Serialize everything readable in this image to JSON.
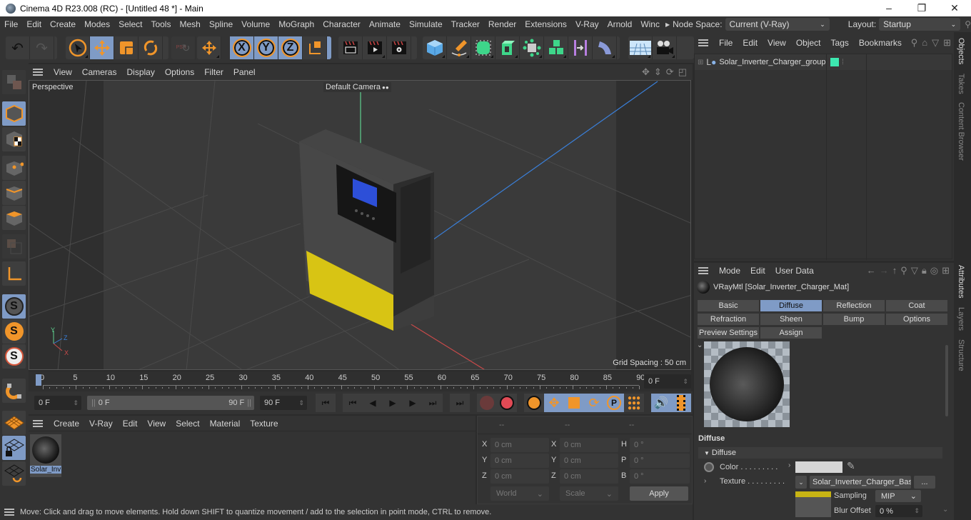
{
  "window": {
    "title": "Cinema 4D R23.008 (RC) - [Untitled 48 *] - Main",
    "controls": [
      "–",
      "❐",
      "✕"
    ]
  },
  "menubar": {
    "items": [
      "File",
      "Edit",
      "Create",
      "Modes",
      "Select",
      "Tools",
      "Mesh",
      "Spline",
      "Volume",
      "MoGraph",
      "Character",
      "Animate",
      "Simulate",
      "Tracker",
      "Render",
      "Extensions",
      "V-Ray",
      "Arnold",
      "Winc"
    ],
    "node_space_label": "Node Space:",
    "node_space_value": "Current (V-Ray)",
    "layout_label": "Layout:",
    "layout_value": "Startup"
  },
  "toolbar": {
    "axis_x": "X",
    "axis_y": "Y",
    "axis_z": "Z",
    "psr": "PSR"
  },
  "viewport": {
    "menu": [
      "View",
      "Cameras",
      "Display",
      "Options",
      "Filter",
      "Panel"
    ],
    "view_name": "Perspective",
    "camera_label": "Default Camera",
    "grid_spacing": "Grid Spacing : 50 cm",
    "axis_labels": {
      "x": "X",
      "y": "Y",
      "z": "Z"
    }
  },
  "timeline": {
    "ticks": [
      "0",
      "5",
      "10",
      "15",
      "20",
      "25",
      "30",
      "35",
      "40",
      "45",
      "50",
      "55",
      "60",
      "65",
      "70",
      "75",
      "80",
      "85",
      "90"
    ],
    "current_frame": "0 F",
    "start_frame": "0 F",
    "range_start": "0 F",
    "range_end": "90 F",
    "end_frame": "90 F"
  },
  "material_manager": {
    "menu": [
      "Create",
      "V-Ray",
      "Edit",
      "View",
      "Select",
      "Material",
      "Texture"
    ],
    "materials": [
      {
        "name": "Solar_Inv"
      }
    ]
  },
  "coordinates": {
    "headers": [
      "--",
      "--",
      "--"
    ],
    "rows": [
      {
        "l1": "X",
        "v1": "0 cm",
        "l2": "X",
        "v2": "0 cm",
        "l3": "H",
        "v3": "0 °"
      },
      {
        "l1": "Y",
        "v1": "0 cm",
        "l2": "Y",
        "v2": "0 cm",
        "l3": "P",
        "v3": "0 °"
      },
      {
        "l1": "Z",
        "v1": "0 cm",
        "l2": "Z",
        "v2": "0 cm",
        "l3": "B",
        "v3": "0 °"
      }
    ],
    "space": "World",
    "mode": "Scale",
    "apply": "Apply"
  },
  "status": {
    "text": "Move: Click and drag to move elements. Hold down SHIFT to quantize movement / add to the selection in point mode, CTRL to remove."
  },
  "objects_panel": {
    "menu": [
      "File",
      "Edit",
      "View",
      "Object",
      "Tags",
      "Bookmarks"
    ],
    "objects": [
      {
        "name": "Solar_Inverter_Charger_group",
        "color": "#3de8b0"
      }
    ]
  },
  "attributes_panel": {
    "menu": [
      "Mode",
      "Edit",
      "User Data"
    ],
    "material_title": "VRayMtl [Solar_Inverter_Charger_Mat]",
    "tabs_row1": [
      "Basic",
      "Diffuse",
      "Reflection",
      "Coat"
    ],
    "tabs_row2": [
      "Refraction",
      "Sheen",
      "Bump",
      "Options"
    ],
    "tabs_row3": [
      "Preview Settings",
      "Assign"
    ],
    "active_tab": "Diffuse",
    "section_title": "Diffuse",
    "group_title": "Diffuse",
    "color_label": "Color . . . . . . . . .",
    "color_value": "#d6d6d6",
    "texture_label": "Texture . . . . . . . . .",
    "texture_value": "Solar_Inverter_Charger_Base",
    "texture_more": "...",
    "sampling_label": "Sampling",
    "sampling_value": "MIP",
    "blur_label": "Blur Offset",
    "blur_value": "0 %"
  },
  "side_tabs": {
    "top": [
      "Objects",
      "Takes",
      "Content Browser"
    ],
    "bottom": [
      "Attributes",
      "Layers",
      "Structure"
    ]
  },
  "colors": {
    "accent": "#7f9bc6",
    "orange": "#f0952a",
    "bg": "#333333"
  }
}
